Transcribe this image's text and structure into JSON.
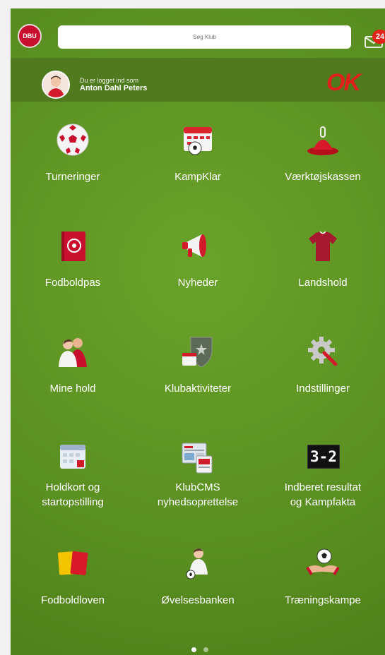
{
  "header": {
    "search_placeholder": "Søg Klub",
    "mail_badge": "24",
    "crest_label": "DBU"
  },
  "user": {
    "logged_in_as": "Du er logget ind som",
    "name": "Anton Dahl Peters",
    "sponsor": "OK"
  },
  "tiles": [
    {
      "label": "Turneringer",
      "icon": "soccer-ball-icon"
    },
    {
      "label": "KampKlar",
      "icon": "calendar-ball-icon"
    },
    {
      "label": "Værktøjskassen",
      "icon": "training-cone-icon"
    },
    {
      "label": "Fodboldpas",
      "icon": "football-passport-icon"
    },
    {
      "label": "Nyheder",
      "icon": "megaphone-icon"
    },
    {
      "label": "Landshold",
      "icon": "national-jersey-icon"
    },
    {
      "label": "Mine hold",
      "icon": "team-players-icon"
    },
    {
      "label": "Klubaktiviteter",
      "icon": "club-shield-calendar-icon"
    },
    {
      "label": "Indstillinger",
      "icon": "settings-gear-icon"
    },
    {
      "label1": "Holdkort og",
      "label2": "startopstilling",
      "icon": "team-card-calendar-icon"
    },
    {
      "label1": "KlubCMS",
      "label2": "nyhedsoprettelse",
      "icon": "cms-screen-icon"
    },
    {
      "label1": "Indberet resultat",
      "label2": "og Kampfakta",
      "icon": "scoreboard-icon",
      "score": "3-2"
    },
    {
      "label": "Fodboldloven",
      "icon": "referee-cards-icon"
    },
    {
      "label": "Øvelsesbanken",
      "icon": "player-exercise-icon"
    },
    {
      "label": "Træningskampe",
      "icon": "handshake-ball-icon"
    }
  ],
  "pagination": {
    "pages": 2,
    "current": 1
  }
}
